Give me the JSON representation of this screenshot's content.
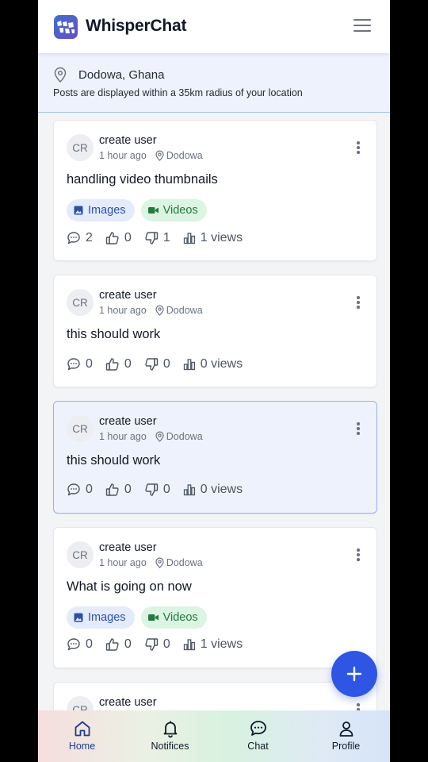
{
  "app": {
    "title": "WhisperChat"
  },
  "location": {
    "name": "Dodowa, Ghana",
    "note": "Posts are displayed within a 35km radius of your location"
  },
  "posts": [
    {
      "initials": "CR",
      "author": "create user",
      "time": "1 hour ago",
      "place": "Dodowa",
      "text": "handling video thumbnails",
      "tags": {
        "images": "Images",
        "videos": "Videos"
      },
      "comments": "2",
      "likes": "0",
      "dislikes": "1",
      "views": "1 views"
    },
    {
      "initials": "CR",
      "author": "create user",
      "time": "1 hour ago",
      "place": "Dodowa",
      "text": "this should work",
      "comments": "0",
      "likes": "0",
      "dislikes": "0",
      "views": "0 views"
    },
    {
      "initials": "CR",
      "author": "create user",
      "time": "1 hour ago",
      "place": "Dodowa",
      "text": "this should work",
      "comments": "0",
      "likes": "0",
      "dislikes": "0",
      "views": "0 views"
    },
    {
      "initials": "CR",
      "author": "create user",
      "time": "1 hour ago",
      "place": "Dodowa",
      "text": "What is going on now",
      "tags": {
        "images": "Images",
        "videos": "Videos"
      },
      "comments": "0",
      "likes": "0",
      "dislikes": "0",
      "views": "1 views"
    },
    {
      "initials": "CR",
      "author": "create user"
    }
  ],
  "nav": {
    "home": "Home",
    "notifications": "Notifices",
    "chat": "Chat",
    "profile": "Profile"
  },
  "colors": {
    "accent": "#2f55e4",
    "active_card_bg": "#eef2fd",
    "images_tag_bg": "#e4ebfb",
    "videos_tag_bg": "#dcf4e2"
  },
  "icons": {
    "menu": "hamburger-icon",
    "location": "map-pin-icon",
    "fab": "plus-icon",
    "comment": "comment-icon",
    "like": "thumbs-up-icon",
    "dislike": "thumbs-down-icon",
    "views": "bar-chart-icon"
  }
}
